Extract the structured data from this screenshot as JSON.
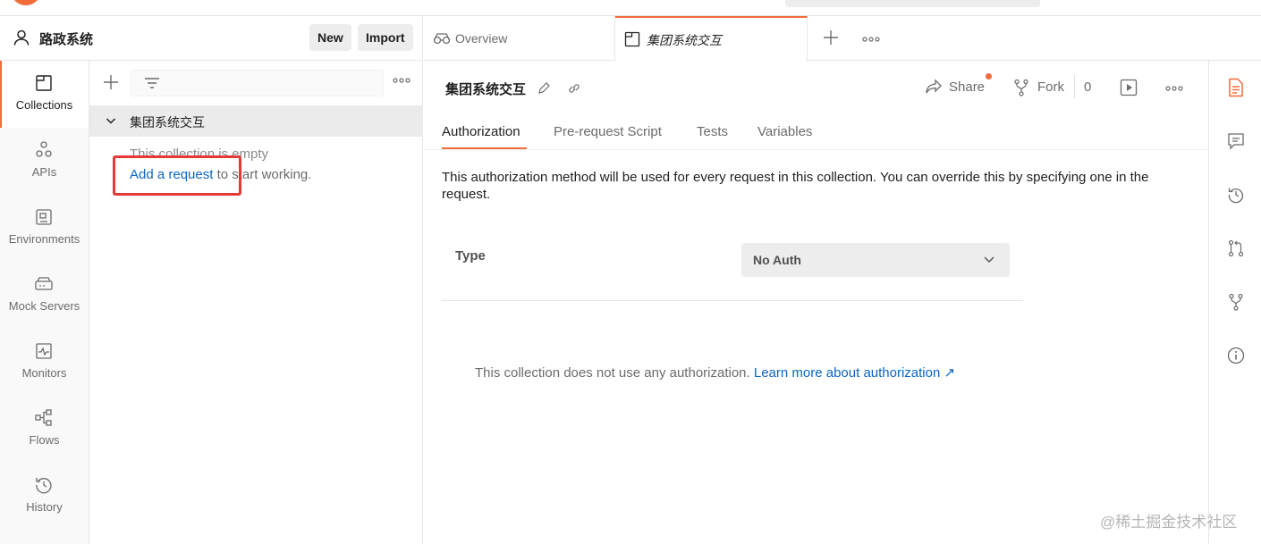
{
  "workspace": {
    "name": "路政系统",
    "new_label": "New",
    "import_label": "Import"
  },
  "rail": {
    "items": [
      {
        "label": "Collections",
        "icon": "collections-icon",
        "active": true
      },
      {
        "label": "APIs",
        "icon": "apis-icon"
      },
      {
        "label": "Environments",
        "icon": "environments-icon"
      },
      {
        "label": "Mock Servers",
        "icon": "mock-servers-icon"
      },
      {
        "label": "Monitors",
        "icon": "monitors-icon"
      },
      {
        "label": "Flows",
        "icon": "flows-icon"
      },
      {
        "label": "History",
        "icon": "history-icon"
      }
    ]
  },
  "collections": {
    "name": "集团系统交互",
    "empty_text": "This collection is empty",
    "add_request_link": "Add a request",
    "add_request_suffix": " to start working."
  },
  "tabs": {
    "overview_label": "Overview",
    "active_label": "集团系统交互"
  },
  "main": {
    "title": "集团系统交互",
    "share_label": "Share",
    "fork_label": "Fork",
    "fork_count": "0",
    "subtabs": [
      "Authorization",
      "Pre-request Script",
      "Tests",
      "Variables"
    ],
    "auth_description": "This authorization method will be used for every request in this collection. You can override this by specifying one in the request.",
    "type_label": "Type",
    "type_value": "No Auth",
    "no_auth_message": "This collection does not use any authorization. ",
    "learn_more_link": "Learn more about authorization ↗"
  },
  "colors": {
    "accent": "#f26b3a",
    "link": "#0b66c3",
    "highlight_box": "#e53935"
  },
  "watermark": "@稀土掘金技术社区"
}
